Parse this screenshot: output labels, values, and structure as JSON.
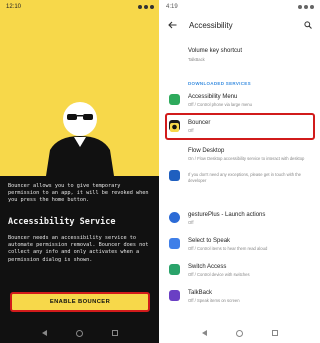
{
  "left": {
    "status_time": "12:10",
    "description": "Bouncer allows you to give temporary permission to an app, it will be revoked when you press the home button.",
    "accessibility_title": "Accessibility Service",
    "accessibility_desc": "Bouncer needs an accessibility service to automate permission removal. Bouncer does not collect any info and only activates when a permission dialog is shown.",
    "enable_button": "ENABLE BOUNCER"
  },
  "right": {
    "status_time": "4:19",
    "title": "Accessibility",
    "volume": {
      "title": "Volume key shortcut",
      "subtitle": "TalkBack"
    },
    "section_header": "DOWNLOADED SERVICES",
    "items": [
      {
        "title": "Accessibility Menu",
        "subtitle": "Off / Control phone via large menu",
        "color": "#2eaa5c",
        "icon": "accessibility-menu-icon"
      },
      {
        "title": "Bouncer",
        "subtitle": "Off",
        "color": "#1a1a1a",
        "icon": "bouncer-icon"
      },
      {
        "title": "Flow Desktop",
        "subtitle": "On / Flow Desktop accessibility service to interact with desktop",
        "color": "#1f5fbf",
        "icon": "flow-desktop-icon"
      },
      {
        "title": "gesturePlus - Launch actions",
        "subtitle": "Off",
        "color": "#2c6bd6",
        "icon": "gestureplus-icon"
      },
      {
        "title": "Select to Speak",
        "subtitle": "Off / Control items to hear them read aloud",
        "color": "#3f7fe8",
        "icon": "select-to-speak-icon"
      },
      {
        "title": "Switch Access",
        "subtitle": "Off / Control device with switches",
        "color": "#2aa36a",
        "icon": "switch-access-icon"
      },
      {
        "title": "TalkBack",
        "subtitle": "Off / Speak items on screen",
        "color": "#6a3fc4",
        "icon": "talkback-icon"
      }
    ],
    "flow_note": "If you don't need any exceptions, please get in touch with the developer"
  },
  "colors": {
    "accent_yellow": "#f7d84a",
    "highlight_red": "#d11b1b",
    "section_blue": "#3b8ee0"
  }
}
